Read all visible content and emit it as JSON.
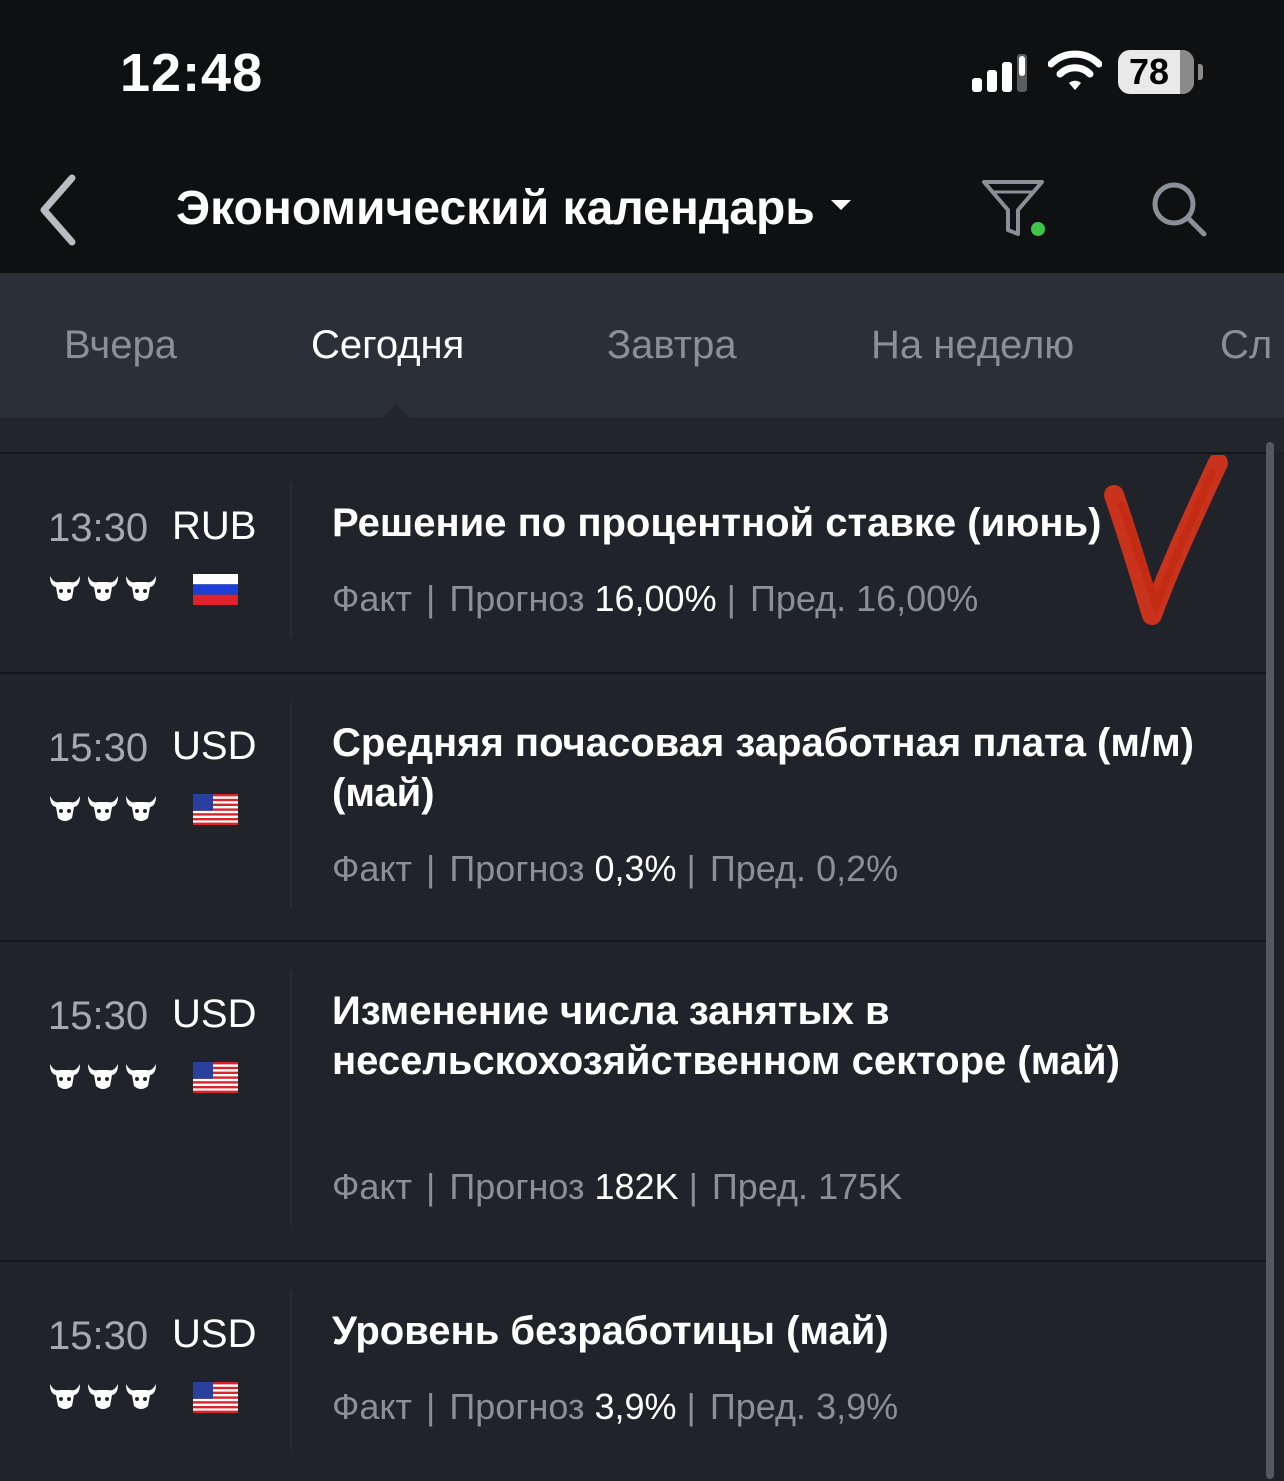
{
  "status_bar": {
    "time": "12:48",
    "battery": "78"
  },
  "header": {
    "title": "Экономический календарь"
  },
  "tabs": [
    {
      "label": "Вчера"
    },
    {
      "label": "Сегодня"
    },
    {
      "label": "Завтра"
    },
    {
      "label": "На неделю"
    },
    {
      "label": "Сл"
    }
  ],
  "events": [
    {
      "time": "13:30",
      "currency": "RUB",
      "flag": "russia-flag-icon",
      "importance": 3,
      "title": "Решение по процентной ставке (июнь)",
      "fact_label": "Факт",
      "forecast_label": "Прогноз",
      "forecast": "16,00%",
      "prev_label": "Пред.",
      "prev": "16,00%"
    },
    {
      "time": "15:30",
      "currency": "USD",
      "flag": "usa-flag-icon",
      "importance": 3,
      "title": "Средняя почасовая заработная плата (м/м) (май)",
      "fact_label": "Факт",
      "forecast_label": "Прогноз",
      "forecast": "0,3%",
      "prev_label": "Пред.",
      "prev": "0,2%"
    },
    {
      "time": "15:30",
      "currency": "USD",
      "flag": "usa-flag-icon",
      "importance": 3,
      "title": "Изменение числа занятых в несельскохозяйственном секторе (май)",
      "fact_label": "Факт",
      "forecast_label": "Прогноз",
      "forecast": "182K",
      "prev_label": "Пред.",
      "prev": "175K"
    },
    {
      "time": "15:30",
      "currency": "USD",
      "flag": "usa-flag-icon",
      "importance": 3,
      "title": "Уровень безработицы (май)",
      "fact_label": "Факт",
      "forecast_label": "Прогноз",
      "forecast": "3,9%",
      "prev_label": "Пред.",
      "prev": "3,9%"
    }
  ],
  "colors": {
    "background": "#1e2128",
    "header": "#0f1012",
    "tabs": "#2b2f38",
    "filter_dot": "#3ec44a",
    "checkmark": "#d8341c"
  }
}
